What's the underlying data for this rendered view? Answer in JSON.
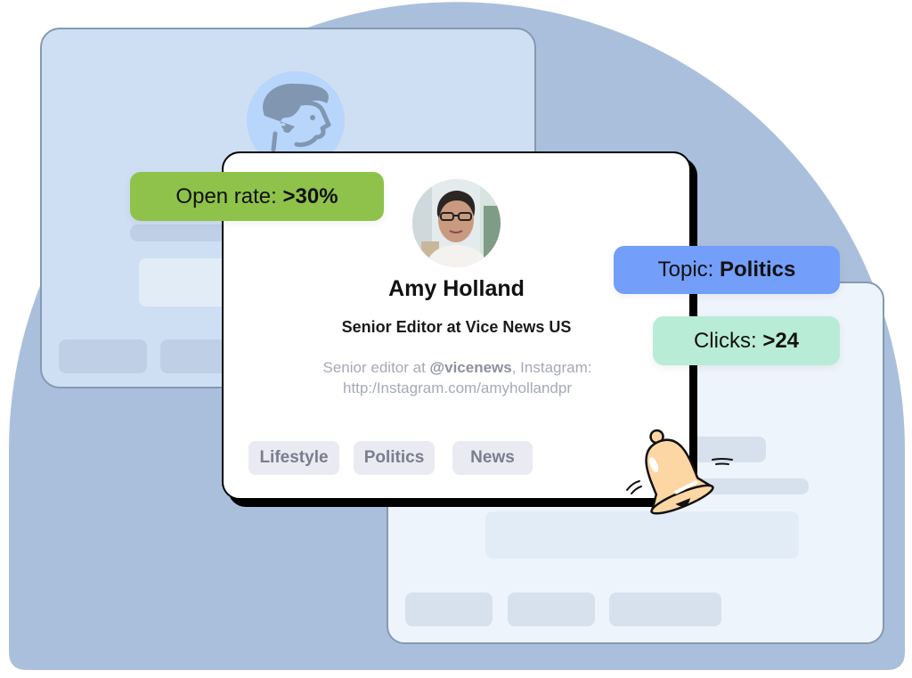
{
  "profile": {
    "name": "Amy Holland",
    "title": "Senior Editor at Vice News US",
    "bio_prefix": "Senior editor at ",
    "bio_handle": "@vicenews",
    "bio_suffix": ", Instagram:",
    "bio_link": "http:/Instagram.com/amyhollandpr",
    "photo_icon": "profile-photo",
    "tags": [
      "Lifestyle",
      "Politics",
      "News"
    ]
  },
  "metrics": {
    "open_rate": {
      "label": "Open rate: ",
      "value": ">30%",
      "color": "#8fc24a"
    },
    "topic": {
      "label": "Topic: ",
      "value": "Politics",
      "color": "#739ef9"
    },
    "clicks": {
      "label": "Clicks: ",
      "value": ">24",
      "color": "#b9ecd6"
    }
  },
  "decorations": {
    "background_color": "#aabfdc",
    "back_card_icon": "person-avatar-icon",
    "bell_icon": "notification-bell-icon",
    "bell_color": "#fcd7a4"
  }
}
